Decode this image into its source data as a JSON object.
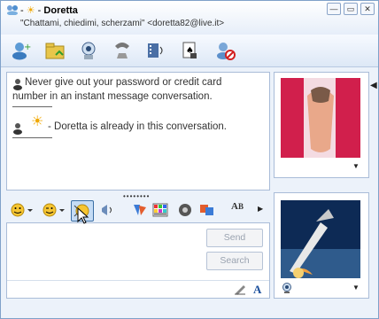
{
  "window": {
    "title_prefix": "-",
    "title_name": "Doretta",
    "subtitle": "\"Chattami, chiedimi, scherzami\" <doretta82@live.it>",
    "controls": [
      "▭",
      "—",
      "✕"
    ]
  },
  "toolbar": {
    "items": [
      {
        "name": "invite-contact-icon"
      },
      {
        "name": "send-files-icon"
      },
      {
        "name": "video-call-icon"
      },
      {
        "name": "phone-call-icon"
      },
      {
        "name": "share-media-icon"
      },
      {
        "name": "games-icon"
      },
      {
        "name": "block-contact-icon"
      }
    ]
  },
  "conversation": {
    "warning": "Never give out your password or credit card number in an instant message conversation.",
    "warning_line1": "Never give out your password or credit card",
    "warning_line2": "number in an instant message conversation.",
    "presence_prefix": "-",
    "presence_text": "- Doretta is already in this conversation."
  },
  "compose": {
    "send_label": "Send",
    "search_label": "Search",
    "input_value": "",
    "drag_handle": "••••••••"
  },
  "format_toolbar": {
    "items": [
      "emoticon",
      "wink",
      "nudge",
      "voice-clip",
      "background",
      "color-grid",
      "sounds",
      "themes",
      "font-size"
    ],
    "font_label": "A"
  },
  "colors": {
    "accent": "#3a6ea5",
    "title_text": "#000000",
    "border": "#a9bcd8"
  }
}
